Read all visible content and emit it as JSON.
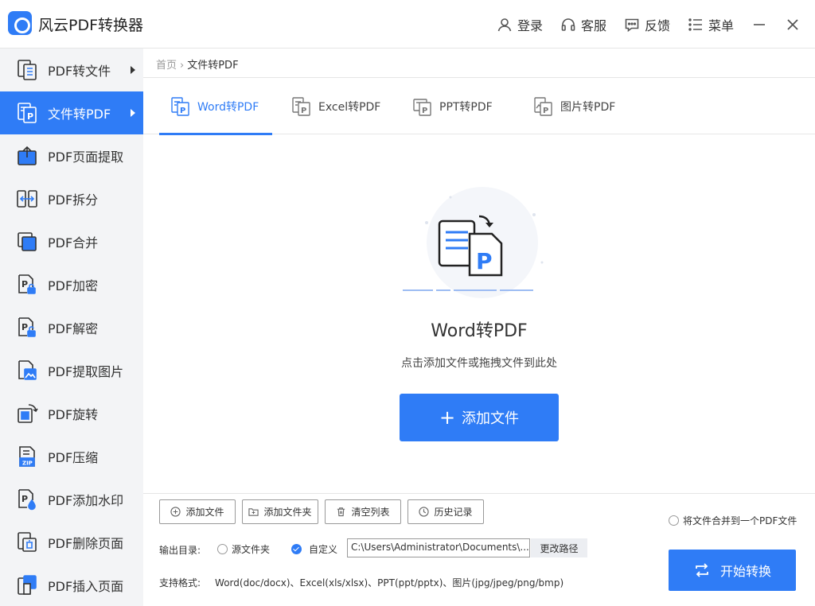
{
  "app": {
    "title": "风云PDF转换器"
  },
  "header": {
    "login": "登录",
    "service": "客服",
    "feedback": "反馈",
    "menu": "菜单"
  },
  "sidebar": {
    "items": [
      {
        "label": "PDF转文件",
        "arrow": true
      },
      {
        "label": "文件转PDF",
        "arrow": true,
        "active": true
      },
      {
        "label": "PDF页面提取"
      },
      {
        "label": "PDF拆分"
      },
      {
        "label": "PDF合并"
      },
      {
        "label": "PDF加密"
      },
      {
        "label": "PDF解密"
      },
      {
        "label": "PDF提取图片"
      },
      {
        "label": "PDF旋转"
      },
      {
        "label": "PDF压缩"
      },
      {
        "label": "PDF添加水印"
      },
      {
        "label": "PDF删除页面"
      },
      {
        "label": "PDF插入页面"
      }
    ]
  },
  "breadcrumb": {
    "home": "首页",
    "current": "文件转PDF"
  },
  "tabs": [
    {
      "label": "Word转PDF",
      "active": true
    },
    {
      "label": "Excel转PDF"
    },
    {
      "label": "PPT转PDF"
    },
    {
      "label": "图片转PDF"
    }
  ],
  "dropzone": {
    "title": "Word转PDF",
    "hint": "点击添加文件或拖拽文件到此处",
    "add_button": "添加文件"
  },
  "toolbar": {
    "add_file": "添加文件",
    "add_folder": "添加文件夹",
    "clear_list": "清空列表",
    "history": "历史记录"
  },
  "output": {
    "label": "输出目录:",
    "source_folder": "源文件夹",
    "custom": "自定义",
    "custom_checked": true,
    "path": "C:\\Users\\Administrator\\Documents\\...",
    "change_path": "更改路径"
  },
  "merge_option": "将文件合并到一个PDF文件",
  "formats": {
    "label": "支持格式:",
    "value": "Word(doc/docx)、Excel(xls/xlsx)、PPT(ppt/pptx)、图片(jpg/jpeg/png/bmp)"
  },
  "start_button": "开始转换",
  "colors": {
    "accent": "#2f7cf6",
    "sidebar_bg": "#f3f4f6"
  }
}
